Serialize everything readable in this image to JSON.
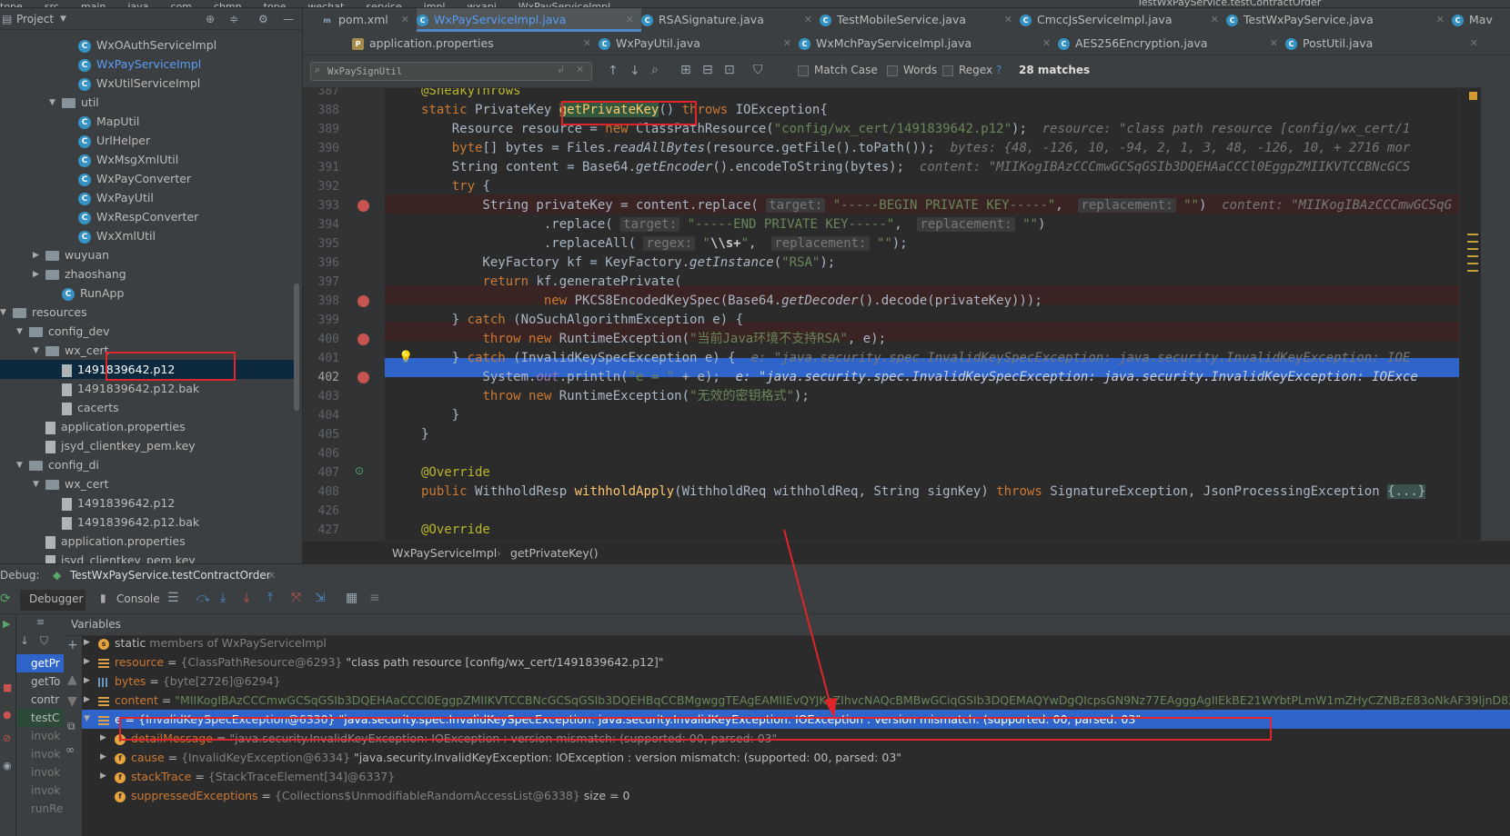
{
  "topbar": {
    "items": [
      "tope",
      "src",
      "main",
      "java",
      "com",
      "chmn",
      "tope",
      "wechat",
      "service",
      "impl",
      "wxapi",
      "WxPayServiceImpl"
    ],
    "run_config": "TestWxPayService.testContractOrder"
  },
  "project": {
    "title": "Project",
    "tree": [
      {
        "label": "WxOAuthServiceImpl",
        "type": "class",
        "indent": 5
      },
      {
        "label": "WxPayServiceImpl",
        "type": "class",
        "indent": 5,
        "link": true
      },
      {
        "label": "WxUtilServiceImpl",
        "type": "class",
        "indent": 5
      },
      {
        "label": "util",
        "type": "folder",
        "indent": 4,
        "expanded": true
      },
      {
        "label": "MapUtil",
        "type": "class",
        "indent": 5
      },
      {
        "label": "UrlHelper",
        "type": "class",
        "indent": 5
      },
      {
        "label": "WxMsgXmlUtil",
        "type": "class",
        "indent": 5
      },
      {
        "label": "WxPayConverter",
        "type": "class",
        "indent": 5
      },
      {
        "label": "WxPayUtil",
        "type": "class",
        "indent": 5
      },
      {
        "label": "WxRespConverter",
        "type": "class",
        "indent": 5
      },
      {
        "label": "WxXmlUtil",
        "type": "class",
        "indent": 5
      },
      {
        "label": "wuyuan",
        "type": "folder",
        "indent": 3,
        "expanded": false
      },
      {
        "label": "zhaoshang",
        "type": "folder",
        "indent": 3,
        "expanded": false
      },
      {
        "label": "RunApp",
        "type": "class",
        "indent": 4
      },
      {
        "label": "resources",
        "type": "folder",
        "indent": 1,
        "expanded": true
      },
      {
        "label": "config_dev",
        "type": "folder",
        "indent": 2,
        "expanded": true
      },
      {
        "label": "wx_cert",
        "type": "folder",
        "indent": 3,
        "expanded": true
      },
      {
        "label": "1491839642.p12",
        "type": "file",
        "indent": 4,
        "selected": true
      },
      {
        "label": "1491839642.p12.bak",
        "type": "file",
        "indent": 4
      },
      {
        "label": "cacerts",
        "type": "file",
        "indent": 4
      },
      {
        "label": "application.properties",
        "type": "file",
        "indent": 3
      },
      {
        "label": "jsyd_clientkey_pem.key",
        "type": "file",
        "indent": 3
      },
      {
        "label": "config_di",
        "type": "folder",
        "indent": 2,
        "expanded": true
      },
      {
        "label": "wx_cert",
        "type": "folder",
        "indent": 3,
        "expanded": true
      },
      {
        "label": "1491839642.p12",
        "type": "file",
        "indent": 4
      },
      {
        "label": "1491839642.p12.bak",
        "type": "file",
        "indent": 4
      },
      {
        "label": "application.properties",
        "type": "file",
        "indent": 3
      },
      {
        "label": "jsyd_clientkey_pem.key",
        "type": "file",
        "indent": 3
      }
    ]
  },
  "tabs_row1": [
    "pom.xml",
    "WxPayServiceImpl.java",
    "RSASignature.java",
    "TestMobileService.java",
    "CmccJsServiceImpl.java",
    "TestWxPayService.java",
    "Mav"
  ],
  "tabs_row2": [
    "application.properties",
    "WxPayUtil.java",
    "WxMchPayServiceImpl.java",
    "AES256Encryption.java",
    "PostUtil.java"
  ],
  "search": {
    "value": "WxPaySignUtil",
    "match_case": "Match Case",
    "words": "Words",
    "regex": "Regex",
    "help": "?",
    "matches": "28 matches"
  },
  "editor": {
    "line_numbers": [
      "387",
      "388",
      "389",
      "390",
      "391",
      "392",
      "393",
      "394",
      "395",
      "396",
      "397",
      "398",
      "399",
      "400",
      "401",
      "402",
      "403",
      "404",
      "405",
      "406",
      "407",
      "408",
      "426",
      "427"
    ],
    "current_line": "402"
  },
  "breadcrumb": {
    "class_name": "WxPayServiceImpl",
    "method": "getPrivateKey()"
  },
  "debug": {
    "label": "Debug:",
    "session": "TestWxPayService.testContractOrder",
    "debugger_tab": "Debugger",
    "console_tab": "Console",
    "variables_label": "Variables",
    "frames": [
      "getPr",
      "getTo",
      "contr",
      "testC",
      "invok",
      "invok",
      "invok",
      "invok",
      "runRe"
    ],
    "vars": [
      {
        "icon": "static",
        "name": "static",
        "value": "members of WxPayServiceImpl",
        "indent": 0,
        "arrow": "▶"
      },
      {
        "icon": "field",
        "name": "resource",
        "eq": " = ",
        "type": "{ClassPathResource@6293}",
        "value": " \"class path resource [config/wx_cert/1491839642.p12]\"",
        "indent": 0,
        "arrow": "▶"
      },
      {
        "icon": "array",
        "name": "bytes",
        "eq": " = ",
        "type": "{byte[2726]@6294}",
        "value": "",
        "indent": 0,
        "arrow": "▶"
      },
      {
        "icon": "field",
        "name": "content",
        "eq": " = ",
        "type": "",
        "value": "\"MIIKogIBAzCCCmwGCSqGSIb3DQEHAaCCCl0EggpZMIIKVTCCBNcGCSqGSIb3DQEHBqCCBMgwggTEAgEAMIIEvQYJKoZIhvcNAQcBMBwGCiqGSIb3DQEMAQYwDgQIcpsGN9Nz77EAgggAgIIEkBE21WYbtPLmW1mZHyCZNBzE83oNkAF39IjnD8X3mC6eTl",
        "indent": 0,
        "arrow": "▶"
      },
      {
        "icon": "field",
        "name": "e",
        "eq": " = ",
        "type": "{InvalidKeySpecException@6330}",
        "value": " \"java.security.spec.InvalidKeySpecException: java.security.InvalidKeyException: IOException : version mismatch: (supported:     00, parsed:     03\"",
        "indent": 0,
        "arrow": "▼",
        "selected": true
      },
      {
        "icon": "f",
        "name": "detailMessage",
        "eq": " = ",
        "type": "",
        "value": "\"java.security.InvalidKeyException: IOException : version mismatch: (supported:     00, parsed:     03\"",
        "indent": 1,
        "arrow": "▶",
        "dim": true
      },
      {
        "icon": "f",
        "name": "cause",
        "eq": " = ",
        "type": "{InvalidKeyException@6334}",
        "value": " \"java.security.InvalidKeyException: IOException : version mismatch: (supported:     00, parsed:     03\"",
        "indent": 1,
        "arrow": "▶"
      },
      {
        "icon": "f",
        "name": "stackTrace",
        "eq": " = ",
        "type": "{StackTraceElement[34]@6337}",
        "value": "",
        "indent": 1,
        "arrow": "▶"
      },
      {
        "icon": "f",
        "name": "suppressedExceptions",
        "eq": " = ",
        "type": "{Collections$UnmodifiableRandomAccessList@6338}",
        "value": "  size = 0",
        "indent": 1,
        "arrow": ""
      }
    ]
  },
  "colors": {
    "accent": "#2f65ca",
    "highlight_red": "#e0242a",
    "breakpoint": "#c75450"
  }
}
